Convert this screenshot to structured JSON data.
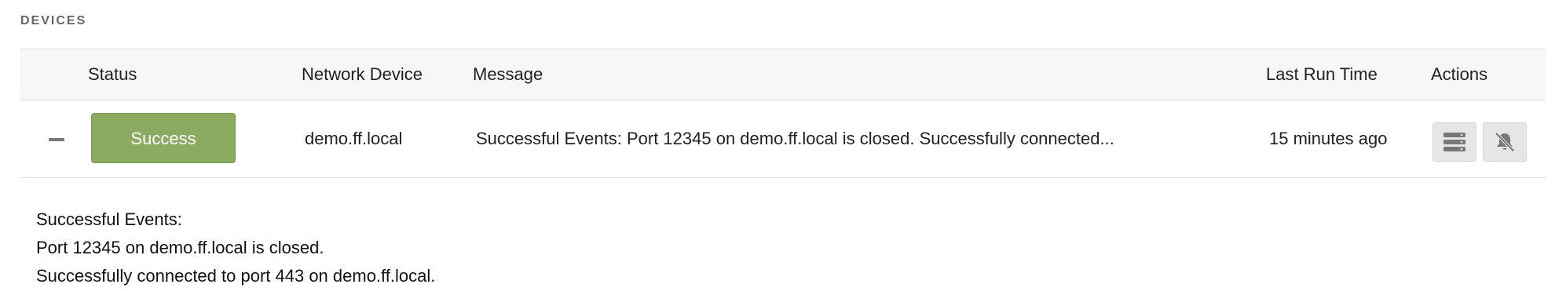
{
  "section": {
    "title": "DEVICES"
  },
  "table": {
    "headers": {
      "status": "Status",
      "device": "Network Device",
      "message": "Message",
      "last_run": "Last Run Time",
      "actions": "Actions"
    },
    "rows": [
      {
        "status": "Success",
        "device": "demo.ff.local",
        "message": "Successful Events: Port 12345 on demo.ff.local is closed. Successfully connected...",
        "last_run": "15 minutes ago",
        "expanded": true
      }
    ]
  },
  "details": {
    "lines": [
      "Successful Events:",
      "Port 12345 on demo.ff.local is closed.",
      "Successfully connected to port 443 on demo.ff.local."
    ]
  },
  "colors": {
    "success": "#8aab60",
    "header_bg": "#f7f7f7",
    "action_bg": "#e6e6e6"
  },
  "icons": {
    "action_1": "server-icon",
    "action_2": "bell-slash-icon",
    "collapse": "minus-icon"
  }
}
